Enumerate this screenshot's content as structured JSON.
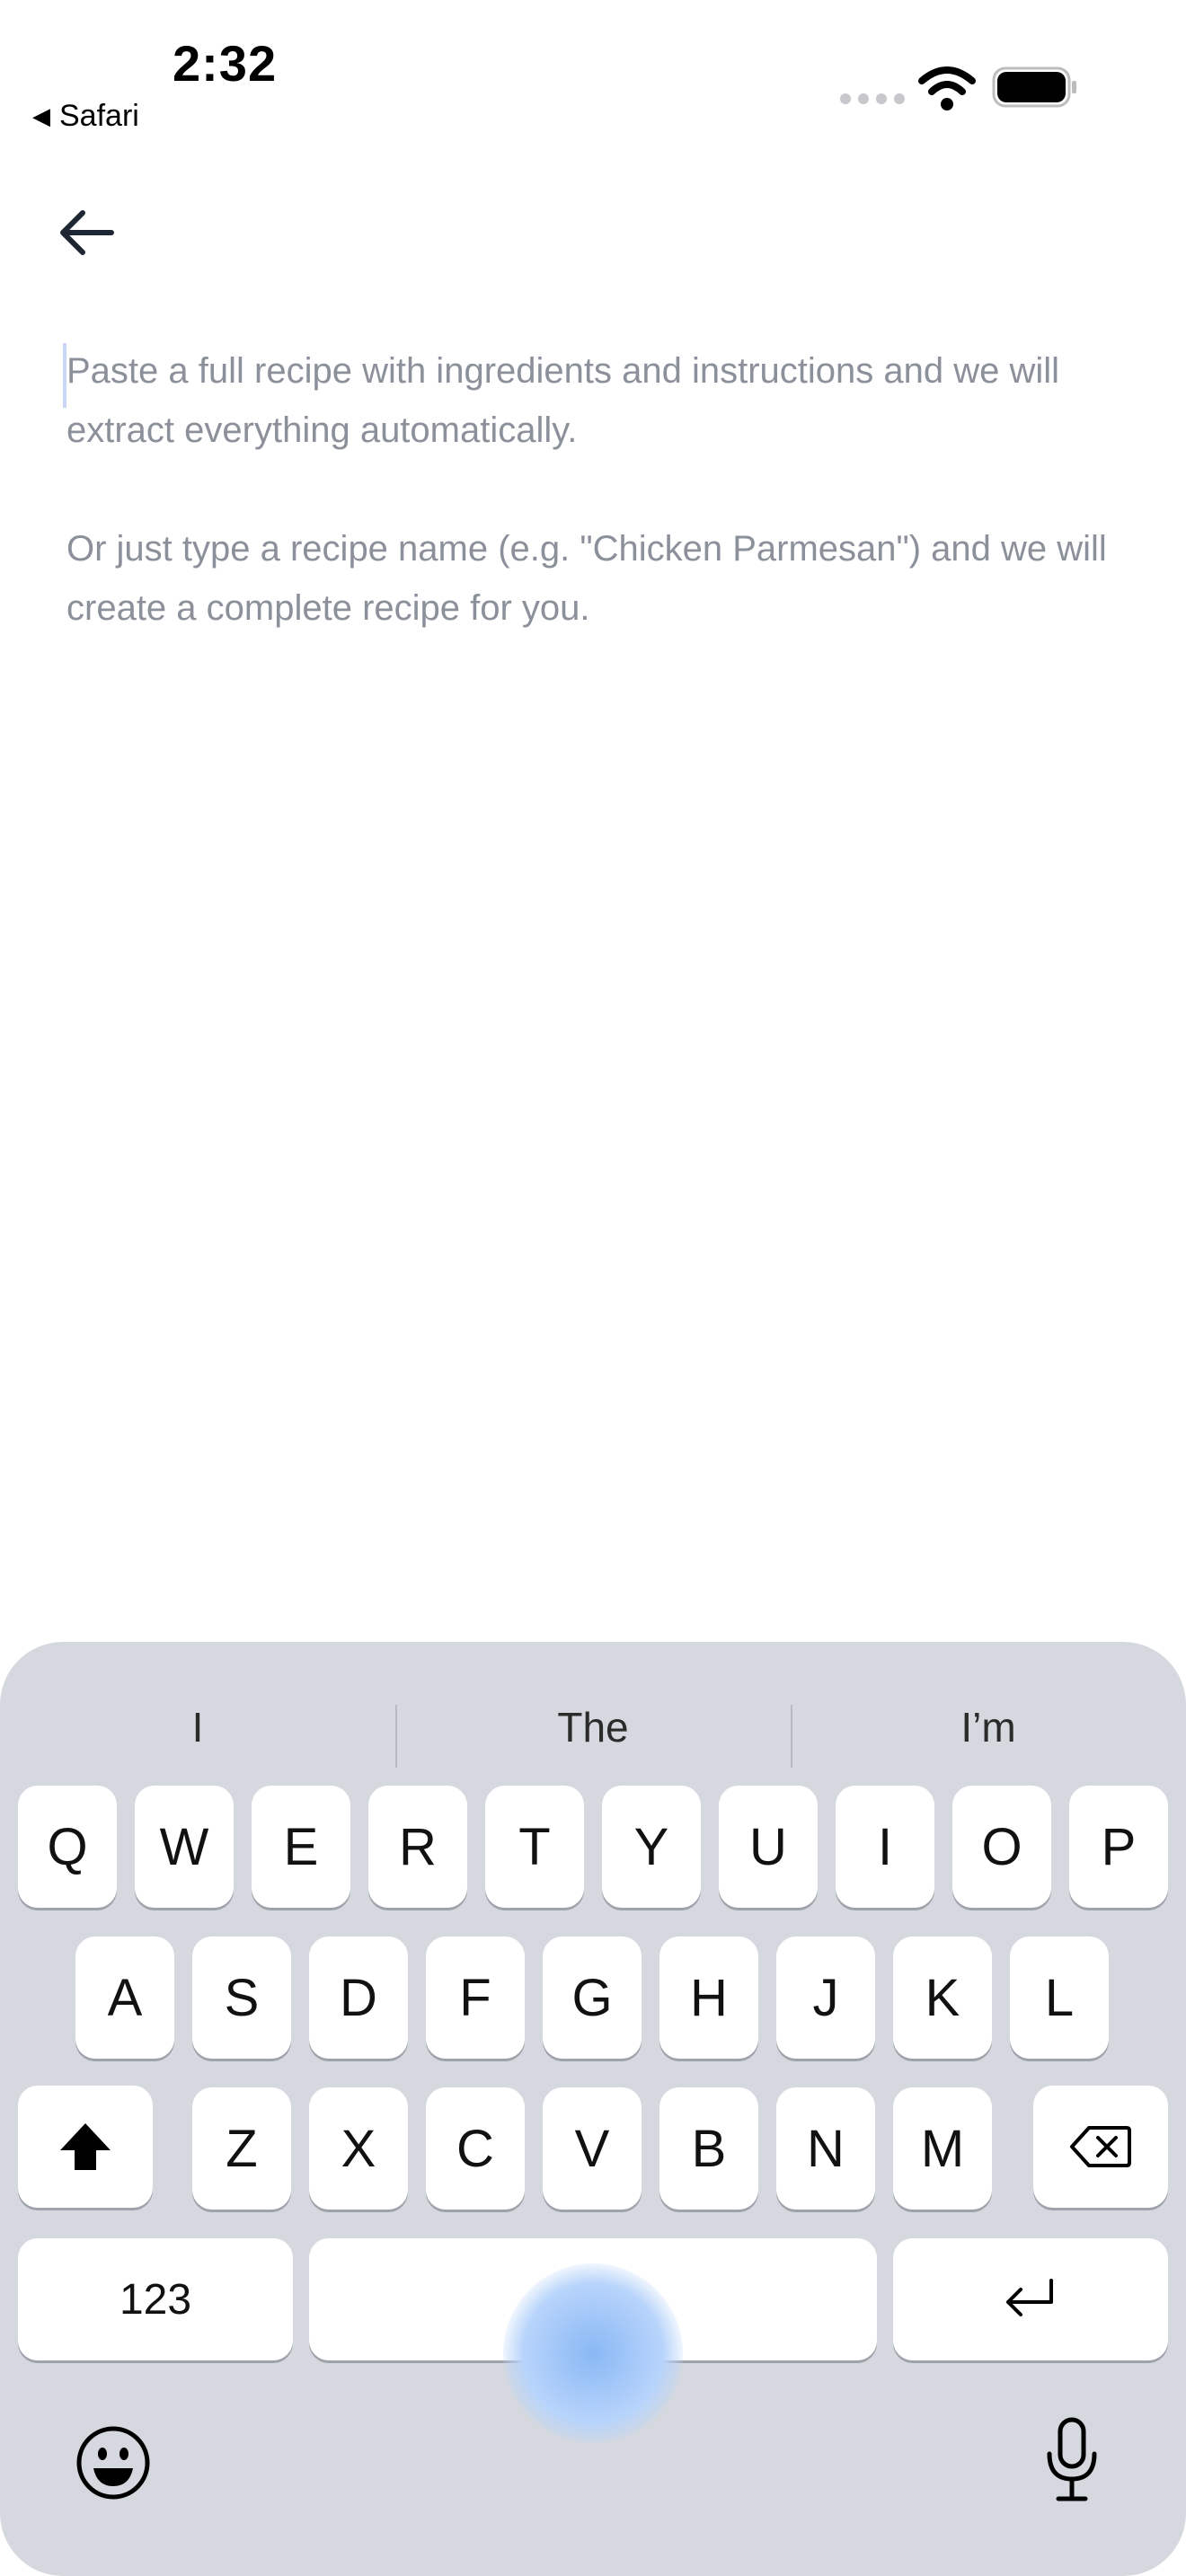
{
  "status_bar": {
    "time": "2:32",
    "back_app": "Safari"
  },
  "editor": {
    "placeholder_line1": "Paste a full recipe with ingredients and instructions and we will extract everything automatically.",
    "placeholder_line2": "Or just type a recipe name (e.g. \"Chicken Parmesan\") and we will create a complete recipe for you."
  },
  "keyboard": {
    "suggestions": [
      "I",
      "The",
      "I’m"
    ],
    "row1": [
      "Q",
      "W",
      "E",
      "R",
      "T",
      "Y",
      "U",
      "I",
      "O",
      "P"
    ],
    "row2": [
      "A",
      "S",
      "D",
      "F",
      "G",
      "H",
      "J",
      "K",
      "L"
    ],
    "row3": [
      "Z",
      "X",
      "C",
      "V",
      "B",
      "N",
      "M"
    ],
    "numbers_label": "123"
  },
  "icons": [
    "back-arrow-icon",
    "wifi-icon",
    "battery-icon",
    "shift-icon",
    "delete-icon",
    "return-icon",
    "emoji-icon",
    "microphone-icon"
  ]
}
